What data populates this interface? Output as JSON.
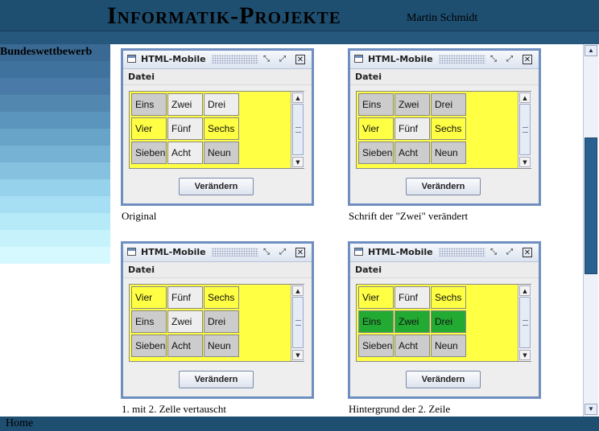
{
  "header": {
    "title": "Informatik-Projekte",
    "author": "Martin Schmidt"
  },
  "sidebar": {
    "heading": "Bundeswettbewerb",
    "bands": [
      "#3a6a94",
      "#40729e",
      "#4a7ba8",
      "#5287b0",
      "#5b94bc",
      "#68a3c8",
      "#76b2d4",
      "#86c2e0",
      "#96d2ec",
      "#a6def4",
      "#b6eaf8",
      "#c6f2fc",
      "#d6f8ff"
    ]
  },
  "footer": {
    "home": "Home"
  },
  "colors": {
    "yellow": "#ffff44",
    "gray": "#cccccc",
    "light": "#eeeeee",
    "green": "#22aa33"
  },
  "panels": [
    {
      "window_title": "HTML-Mobile",
      "menu_file": "Datei",
      "button_label": "Verändern",
      "caption": "Original",
      "cells": [
        {
          "text": "Eins",
          "bg": "#cccccc",
          "bold": false,
          "mono": false
        },
        {
          "text": "Zwei",
          "bg": "#eeeeee",
          "bold": false,
          "mono": false
        },
        {
          "text": "Drei",
          "bg": "#eeeeee",
          "bold": false,
          "mono": false
        },
        {
          "text": "Vier",
          "bg": "#ffff44",
          "bold": false,
          "mono": false
        },
        {
          "text": "Fünf",
          "bg": "#eeeeee",
          "bold": false,
          "mono": false
        },
        {
          "text": "Sechs",
          "bg": "#ffff44",
          "bold": false,
          "mono": false
        },
        {
          "text": "Sieben",
          "bg": "#cccccc",
          "bold": false,
          "mono": false
        },
        {
          "text": "Acht",
          "bg": "#eeeeee",
          "bold": false,
          "mono": false
        },
        {
          "text": "Neun",
          "bg": "#cccccc",
          "bold": false,
          "mono": true
        }
      ]
    },
    {
      "window_title": "HTML-Mobile",
      "menu_file": "Datei",
      "button_label": "Verändern",
      "caption": "Schrift der \"Zwei\" verändert",
      "cells": [
        {
          "text": "Eins",
          "bg": "#cccccc",
          "bold": false,
          "mono": false
        },
        {
          "text": "Zwei",
          "bg": "#cccccc",
          "bold": true,
          "mono": false
        },
        {
          "text": "Drei",
          "bg": "#cccccc",
          "bold": false,
          "mono": false
        },
        {
          "text": "Vier",
          "bg": "#ffff44",
          "bold": false,
          "mono": false
        },
        {
          "text": "Fünf",
          "bg": "#eeeeee",
          "bold": false,
          "mono": false
        },
        {
          "text": "Sechs",
          "bg": "#ffff44",
          "bold": false,
          "mono": false
        },
        {
          "text": "Sieben",
          "bg": "#cccccc",
          "bold": false,
          "mono": false
        },
        {
          "text": "Acht",
          "bg": "#cccccc",
          "bold": false,
          "mono": false
        },
        {
          "text": "Neun",
          "bg": "#cccccc",
          "bold": false,
          "mono": true
        }
      ]
    },
    {
      "window_title": "HTML-Mobile",
      "menu_file": "Datei",
      "button_label": "Verändern",
      "caption": "1. mit 2. Zelle vertauscht",
      "cells": [
        {
          "text": "Vier",
          "bg": "#ffff44",
          "bold": false,
          "mono": false
        },
        {
          "text": "Fünf",
          "bg": "#eeeeee",
          "bold": false,
          "mono": false
        },
        {
          "text": "Sechs",
          "bg": "#ffff44",
          "bold": false,
          "mono": false
        },
        {
          "text": "Eins",
          "bg": "#cccccc",
          "bold": false,
          "mono": false
        },
        {
          "text": "Zwei",
          "bg": "#eeeeee",
          "bold": true,
          "mono": false
        },
        {
          "text": "Drei",
          "bg": "#cccccc",
          "bold": false,
          "mono": false
        },
        {
          "text": "Sieben",
          "bg": "#cccccc",
          "bold": false,
          "mono": false
        },
        {
          "text": "Acht",
          "bg": "#cccccc",
          "bold": false,
          "mono": false
        },
        {
          "text": "Neun",
          "bg": "#cccccc",
          "bold": false,
          "mono": true
        }
      ]
    },
    {
      "window_title": "HTML-Mobile",
      "menu_file": "Datei",
      "button_label": "Verändern",
      "caption": "Hintergrund der 2. Zeile",
      "cells": [
        {
          "text": "Vier",
          "bg": "#ffff44",
          "bold": false,
          "mono": false
        },
        {
          "text": "Fünf",
          "bg": "#eeeeee",
          "bold": false,
          "mono": false
        },
        {
          "text": "Sechs",
          "bg": "#ffff44",
          "bold": false,
          "mono": false
        },
        {
          "text": "Eins",
          "bg": "#22aa33",
          "bold": false,
          "mono": false
        },
        {
          "text": "Zwei",
          "bg": "#22aa33",
          "bold": true,
          "mono": false
        },
        {
          "text": "Drei",
          "bg": "#22aa33",
          "bold": false,
          "mono": false
        },
        {
          "text": "Sieben",
          "bg": "#cccccc",
          "bold": false,
          "mono": false
        },
        {
          "text": "Acht",
          "bg": "#cccccc",
          "bold": false,
          "mono": false
        },
        {
          "text": "Neun",
          "bg": "#cccccc",
          "bold": false,
          "mono": true
        }
      ]
    }
  ]
}
